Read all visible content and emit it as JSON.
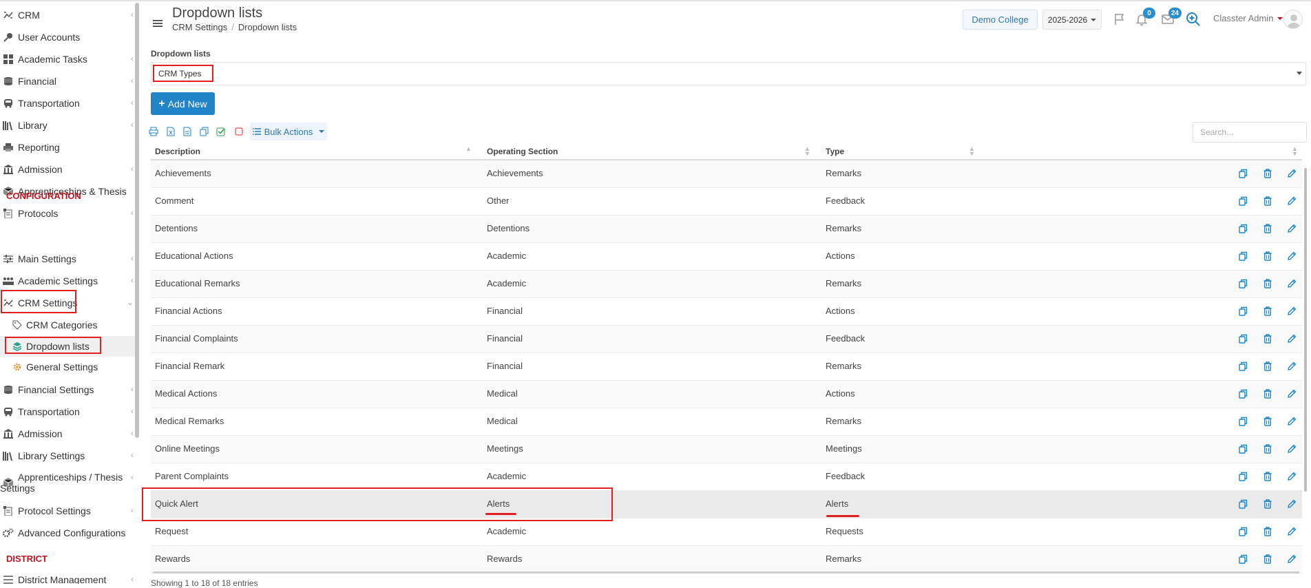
{
  "sidebar": {
    "items": [
      {
        "label": "CRM",
        "icon": "crm-icon"
      },
      {
        "label": "User Accounts",
        "icon": "key-icon"
      },
      {
        "label": "Academic Tasks",
        "icon": "grid-icon"
      },
      {
        "label": "Financial",
        "icon": "coins-icon"
      },
      {
        "label": "Transportation",
        "icon": "bus-icon"
      },
      {
        "label": "Library",
        "icon": "library-icon"
      },
      {
        "label": "Reporting",
        "icon": "printer-icon"
      },
      {
        "label": "Admission",
        "icon": "building-icon"
      },
      {
        "label": "Apprenticeships & Thesis",
        "icon": "box-icon"
      },
      {
        "label": "Protocols",
        "icon": "protocol-icon"
      }
    ],
    "config_heading": "CONFIGURATION",
    "config_items": [
      {
        "label": "Main Settings",
        "icon": "sliders-icon"
      },
      {
        "label": "Academic Settings",
        "icon": "users-icon"
      },
      {
        "label": "CRM Settings",
        "icon": "crm-icon"
      }
    ],
    "crm_sub": [
      {
        "label": "CRM Categories",
        "icon": "tag-icon"
      },
      {
        "label": "Dropdown lists",
        "icon": "layers-icon"
      },
      {
        "label": "General Settings",
        "icon": "gear-icon"
      }
    ],
    "config_items_2": [
      {
        "label": "Financial Settings",
        "icon": "coins-icon"
      },
      {
        "label": "Transportation",
        "icon": "bus-icon"
      },
      {
        "label": "Admission",
        "icon": "building-icon"
      },
      {
        "label": "Library Settings",
        "icon": "library-icon"
      },
      {
        "label_line1": "Apprenticeships / Thesis",
        "label_line2": "Settings",
        "icon": "box-icon"
      },
      {
        "label": "Protocol Settings",
        "icon": "protocol-icon"
      },
      {
        "label": "Advanced Configurations",
        "icon": "gears-icon"
      }
    ],
    "district_heading": "DISTRICT",
    "district_items": [
      {
        "label": "District Management",
        "icon": "list-icon"
      }
    ]
  },
  "header": {
    "title": "Dropdown lists",
    "breadcrumb": [
      "CRM Settings",
      "Dropdown lists"
    ],
    "college": "Demo College",
    "year": "2025-2026",
    "notifications_count": "0",
    "messages_count": "24",
    "user": "Classter Admin"
  },
  "filter": {
    "label": "Dropdown lists",
    "selected": "CRM Types"
  },
  "toolbar": {
    "add_label": "Add New",
    "bulk_label": "Bulk Actions",
    "search_placeholder": "Search..."
  },
  "table": {
    "columns": [
      "Description",
      "Operating Section",
      "Type"
    ],
    "rows": [
      {
        "description": "Achievements",
        "section": "Achievements",
        "type": "Remarks"
      },
      {
        "description": "Comment",
        "section": "Other",
        "type": "Feedback"
      },
      {
        "description": "Detentions",
        "section": "Detentions",
        "type": "Remarks"
      },
      {
        "description": "Educational Actions",
        "section": "Academic",
        "type": "Actions"
      },
      {
        "description": "Educational Remarks",
        "section": "Academic",
        "type": "Remarks"
      },
      {
        "description": "Financial Actions",
        "section": "Financial",
        "type": "Actions"
      },
      {
        "description": "Financial Complaints",
        "section": "Financial",
        "type": "Feedback"
      },
      {
        "description": "Financial Remark",
        "section": "Financial",
        "type": "Remarks"
      },
      {
        "description": "Medical Actions",
        "section": "Medical",
        "type": "Actions"
      },
      {
        "description": "Medical Remarks",
        "section": "Medical",
        "type": "Remarks"
      },
      {
        "description": "Online Meetings",
        "section": "Meetings",
        "type": "Meetings"
      },
      {
        "description": "Parent Complaints",
        "section": "Academic",
        "type": "Feedback"
      },
      {
        "description": "Quick Alert",
        "section": "Alerts",
        "type": "Alerts"
      },
      {
        "description": "Request",
        "section": "Academic",
        "type": "Requests"
      },
      {
        "description": "Rewards",
        "section": "Rewards",
        "type": "Remarks"
      }
    ],
    "footer": "Showing 1 to 18 of 18 entries"
  },
  "colors": {
    "accent": "#2183c8",
    "highlight": "#e02020",
    "section_heading": "#c0141e"
  }
}
